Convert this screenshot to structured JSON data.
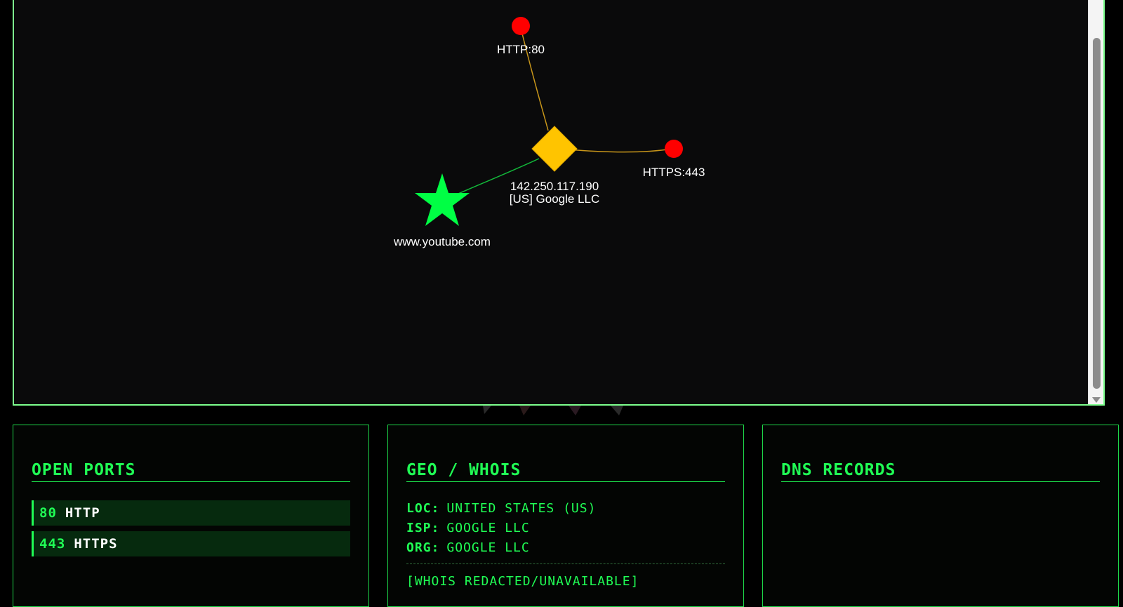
{
  "graph": {
    "nodes": [
      {
        "id": "http",
        "label": "HTTP:80",
        "shape": "circle",
        "color": "#ff0000"
      },
      {
        "id": "https",
        "label": "HTTPS:443",
        "shape": "circle",
        "color": "#ff0000"
      },
      {
        "id": "ip",
        "label_line1": "142.250.117.190",
        "label_line2": "[US] Google LLC",
        "shape": "diamond",
        "color": "#ffc400"
      },
      {
        "id": "domain",
        "label": "www.youtube.com",
        "shape": "star",
        "color": "#00ff44"
      }
    ],
    "edges": [
      {
        "from": "ip",
        "to": "http",
        "color": "#c8961a"
      },
      {
        "from": "ip",
        "to": "https",
        "color": "#c8961a"
      },
      {
        "from": "ip",
        "to": "domain",
        "color": "#12b83a"
      }
    ]
  },
  "panels": {
    "ports": {
      "title": "OPEN PORTS",
      "items": [
        {
          "port": "80",
          "service": "HTTP"
        },
        {
          "port": "443",
          "service": "HTTPS"
        }
      ]
    },
    "geo": {
      "title": "GEO / WHOIS",
      "rows": [
        {
          "key": "LOC:",
          "value": "UNITED STATES (US)"
        },
        {
          "key": "ISP:",
          "value": "GOOGLE LLC"
        },
        {
          "key": "ORG:",
          "value": "GOOGLE LLC"
        }
      ],
      "whois_note": "[WHOIS REDACTED/UNAVAILABLE]"
    },
    "dns": {
      "title": "DNS RECORDS"
    }
  },
  "colors": {
    "accent": "#20ff55",
    "panel_border": "#1ed94a",
    "graph_border": "#7dff8e",
    "graph_bg": "#0a0a0b"
  }
}
